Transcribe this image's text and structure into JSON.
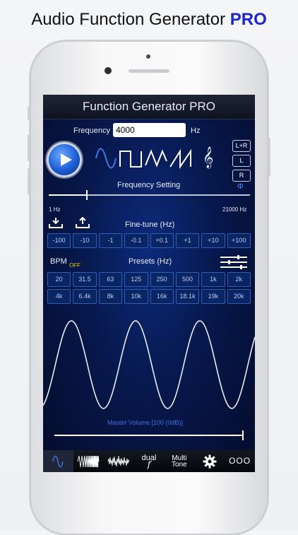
{
  "headline": {
    "text": "Audio Function Generator",
    "badge": "PRO"
  },
  "app": {
    "title": "Function Generator PRO",
    "frequency": {
      "label": "Frequency",
      "value": "4000",
      "unit": "Hz"
    },
    "channels": [
      "L+R",
      "L",
      "R"
    ],
    "phase_symbol": "Φ",
    "frequency_setting": {
      "label": "Frequency Setting",
      "min_label": "1 Hz",
      "max_label": "21000 Hz"
    },
    "finetune": {
      "label": "Fine-tune (Hz)",
      "buttons": [
        "-100",
        "-10",
        "-1",
        "-0.1",
        "+0.1",
        "+1",
        "+10",
        "+100"
      ]
    },
    "bpm": {
      "label": "BPM",
      "state": "OFF"
    },
    "presets": {
      "label": "Presets (Hz)",
      "row1": [
        "20",
        "31.5",
        "63",
        "125",
        "250",
        "500",
        "1k",
        "2k"
      ],
      "row2": [
        "4k",
        "6.4k",
        "8k",
        "10k",
        "16k",
        "18.1k",
        "19k",
        "20k"
      ]
    },
    "master_volume": {
      "label": "Master Volume [100 (0dB)]",
      "level": 1.0
    },
    "tabs": [
      {
        "kind": "sine-icon"
      },
      {
        "kind": "sweep-icon"
      },
      {
        "kind": "noise-icon"
      },
      {
        "line1": "dual",
        "line2": "f"
      },
      {
        "line1": "Multi",
        "line2": "Tone"
      },
      {
        "kind": "gear-icon"
      },
      {
        "kind": "more-icon",
        "text": "OOO"
      }
    ],
    "colors": {
      "accent": "#3f6fe0",
      "bpm_off": "#f0c800",
      "wave": "#e6ebf5"
    }
  }
}
